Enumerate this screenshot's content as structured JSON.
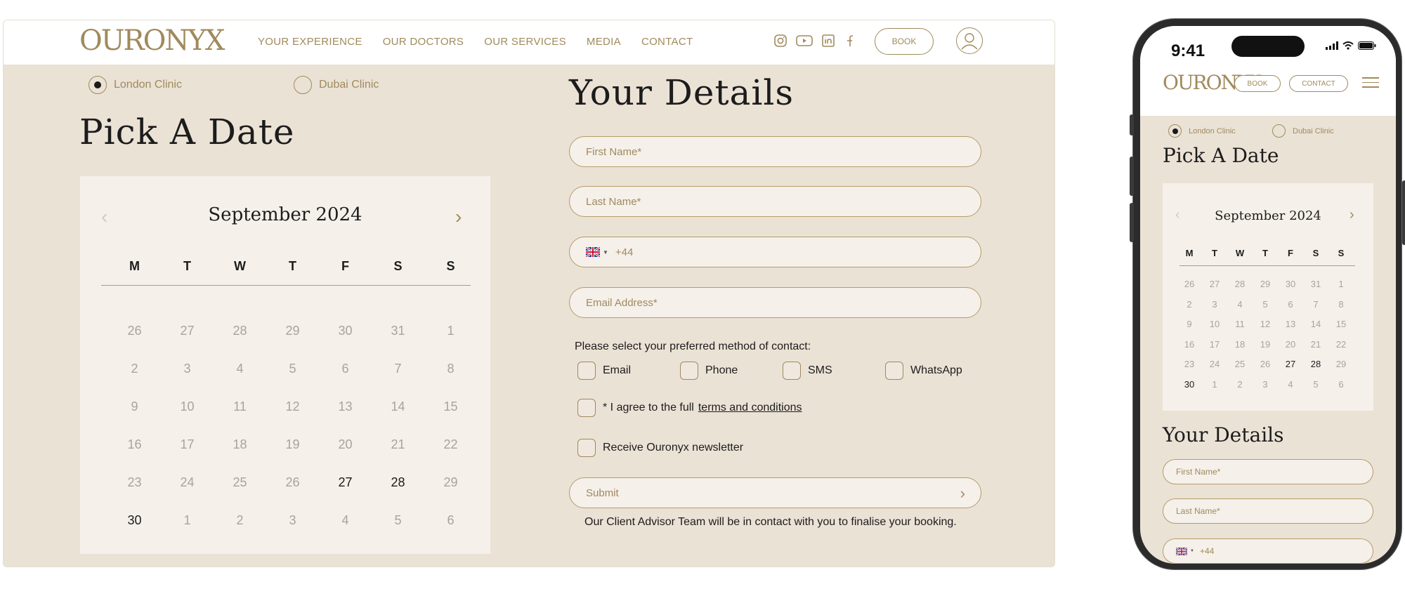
{
  "brand": {
    "logo_text": "OURONYX"
  },
  "nav": {
    "items": [
      "YOUR EXPERIENCE",
      "OUR DOCTORS",
      "OUR SERVICES",
      "MEDIA",
      "CONTACT"
    ],
    "book_label": "BOOK",
    "contact_label": "CONTACT",
    "socials": [
      "instagram-icon",
      "youtube-icon",
      "linkedin-icon",
      "facebook-icon"
    ]
  },
  "clinics": [
    {
      "label": "London Clinic",
      "selected": true
    },
    {
      "label": "Dubai Clinic",
      "selected": false
    }
  ],
  "calendar": {
    "heading": "Pick A Date",
    "month": "September 2024",
    "weekdays": [
      "M",
      "T",
      "W",
      "T",
      "F",
      "S",
      "S"
    ],
    "days": [
      "26",
      "27",
      "28",
      "29",
      "30",
      "31",
      "1",
      "2",
      "3",
      "4",
      "5",
      "6",
      "7",
      "8",
      "9",
      "10",
      "11",
      "12",
      "13",
      "14",
      "15",
      "16",
      "17",
      "18",
      "19",
      "20",
      "21",
      "22",
      "23",
      "24",
      "25",
      "26",
      "27",
      "28",
      "29",
      "30",
      "1",
      "2",
      "3",
      "4",
      "5",
      "6"
    ],
    "available": [
      32,
      33,
      35
    ]
  },
  "form": {
    "heading": "Your Details",
    "first_name_placeholder": "First Name*",
    "last_name_placeholder": "Last Name*",
    "phone_code": "+44",
    "email_placeholder": "Email Address*",
    "contact_question": "Please select your preferred method of contact:",
    "contact_methods": [
      "Email",
      "Phone",
      "SMS",
      "WhatsApp"
    ],
    "terms_prefix": "* I agree to the full",
    "terms_link": "terms and conditions",
    "newsletter": "Receive Ouronyx newsletter",
    "submit": "Submit",
    "note": "Our Client Advisor Team will be in contact with you to finalise your booking."
  },
  "phone": {
    "time": "9:41"
  },
  "colors": {
    "accent": "#a08a5c",
    "background": "#ebe2d6",
    "panel": "#f5f0ea"
  }
}
